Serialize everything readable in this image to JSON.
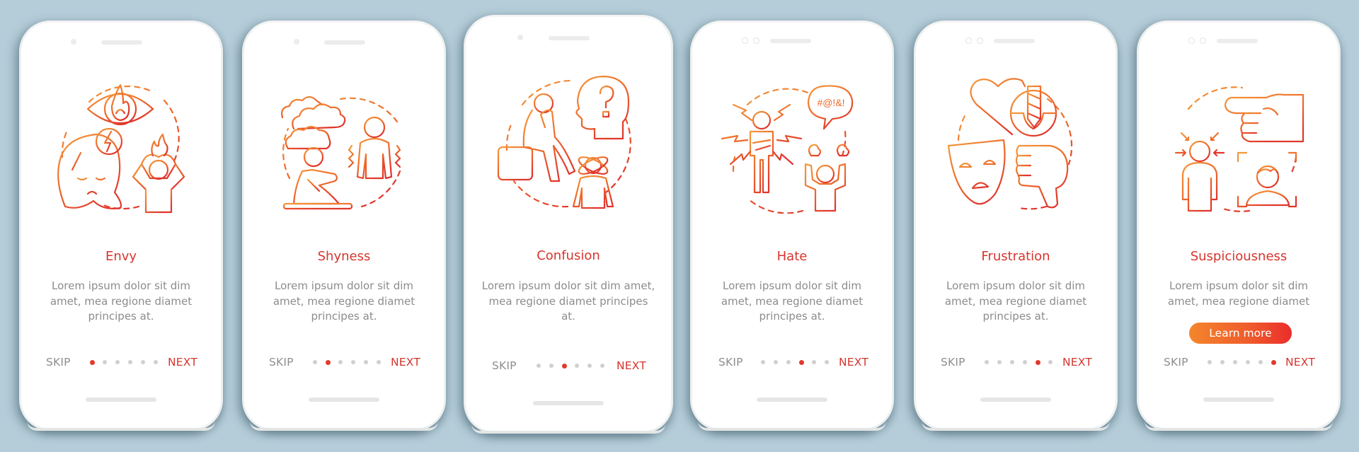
{
  "colors": {
    "background": "#b5cdd9",
    "accent": "#d6352e",
    "gradient_start": "#f4862c",
    "gradient_end": "#e0362c",
    "dot_active": "#e03a2c",
    "dot_inactive": "#d0d0d0",
    "body_text": "#8c8c8c"
  },
  "screens": [
    {
      "title": "Envy",
      "body": "Lorem ipsum dolor sit dim amet, mea regione diamet principes at.",
      "skip_label": "SKIP",
      "next_label": "NEXT",
      "active_page": 1,
      "page_count": 6,
      "illustration": [
        "eye-fire-icon",
        "woman-lightning-icon",
        "person-head-fire-icon"
      ]
    },
    {
      "title": "Shyness",
      "body": "Lorem ipsum dolor sit dim amet, mea regione diamet principes at.",
      "skip_label": "SKIP",
      "next_label": "NEXT",
      "active_page": 2,
      "page_count": 6,
      "illustration": [
        "clouds-icon",
        "sitting-person-icon",
        "trembling-person-icon"
      ]
    },
    {
      "title": "Confusion",
      "body": "Lorem ipsum dolor sit dim amet, mea regione diamet principes at.",
      "skip_label": "SKIP",
      "next_label": "NEXT",
      "active_page": 3,
      "page_count": 6,
      "illustration": [
        "thinking-person-icon",
        "head-question-icon",
        "dizzy-person-icon"
      ]
    },
    {
      "title": "Hate",
      "body": "Lorem ipsum dolor sit dim amet, mea regione diamet principes at.",
      "skip_label": "SKIP",
      "next_label": "NEXT",
      "active_page": 4,
      "page_count": 6,
      "speech_text": "#@!&!",
      "illustration": [
        "angry-person-lightning-icon",
        "speech-bubble-icon",
        "fuming-person-icon"
      ]
    },
    {
      "title": "Frustration",
      "body": "Lorem ipsum dolor sit dim amet, mea regione diamet principes at.",
      "skip_label": "SKIP",
      "next_label": "NEXT",
      "active_page": 5,
      "page_count": 6,
      "illustration": [
        "heart-drill-icon",
        "sad-mask-icon",
        "thumbs-down-icon"
      ]
    },
    {
      "title": "Suspiciousness",
      "body": "Lorem ipsum dolor sit dim amet, mea regione diamet",
      "skip_label": "SKIP",
      "next_label": "NEXT",
      "button_label": "Learn more",
      "active_page": 6,
      "page_count": 6,
      "illustration": [
        "pointing-hand-icon",
        "targeted-person-icon",
        "face-scan-icon"
      ]
    }
  ]
}
